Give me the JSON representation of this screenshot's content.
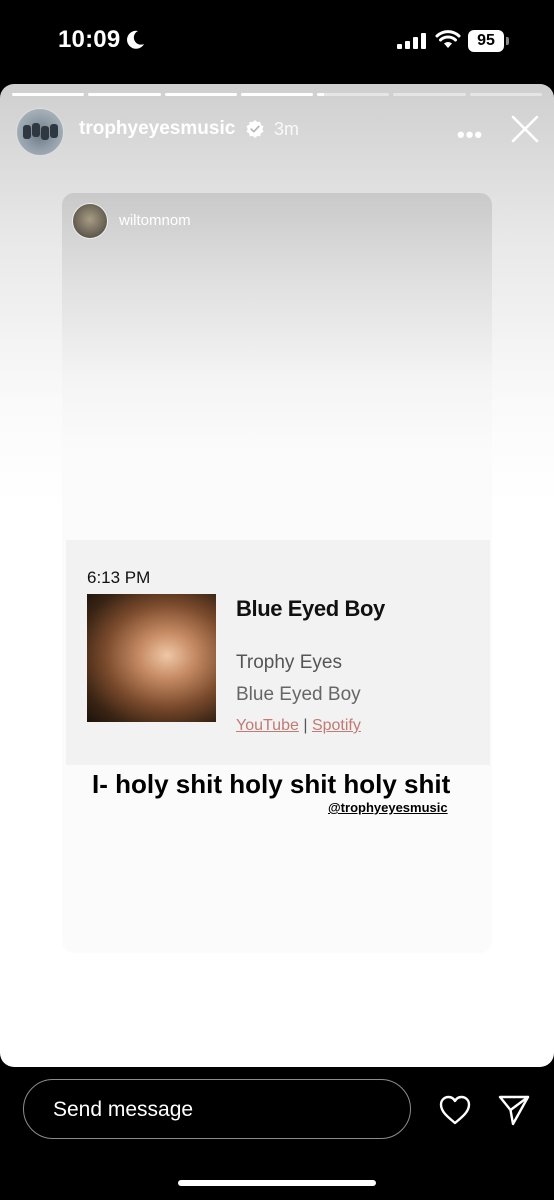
{
  "status_bar": {
    "time": "10:09",
    "battery": "95",
    "icons": [
      "moon-icon",
      "signal-icon",
      "wifi-icon",
      "battery-icon"
    ]
  },
  "story": {
    "progress": [
      1,
      1,
      1,
      1,
      0.1,
      0,
      0
    ],
    "header": {
      "username": "trophyeyesmusic",
      "time_ago": "3m",
      "more": "•••"
    },
    "card": {
      "username": "wiltomnom",
      "music": {
        "time": "6:13 PM",
        "title": "Blue Eyed Boy",
        "artist": "Trophy Eyes",
        "album": "Blue Eyed Boy",
        "link_youtube": "YouTube",
        "separator": "|",
        "link_spotify": "Spotify"
      }
    },
    "caption": "I- holy shit holy shit holy shit",
    "mention": "@trophyeyesmusic"
  },
  "bottom_bar": {
    "message_placeholder": "Send message",
    "icons": [
      "heart-icon",
      "send-icon"
    ]
  },
  "colors": {
    "link": "#c07b74",
    "background": "#000000"
  }
}
